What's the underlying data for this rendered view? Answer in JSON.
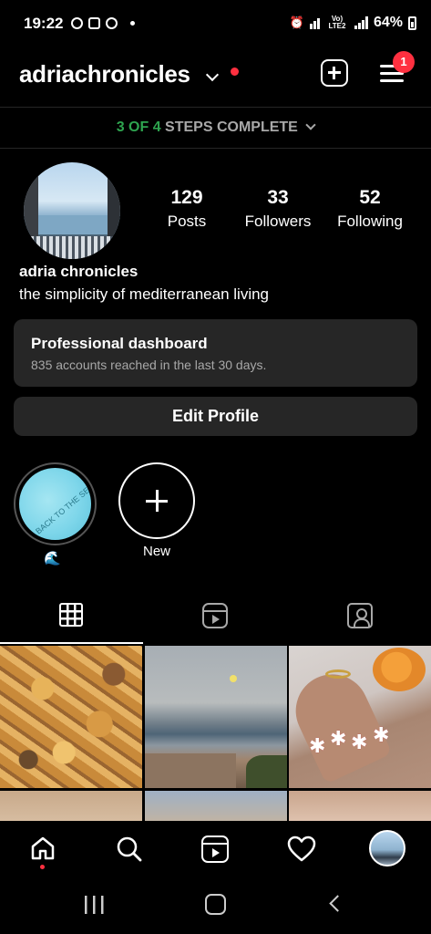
{
  "status_bar": {
    "time": "19:22",
    "network": "Vo) LTE2",
    "battery": "64%"
  },
  "header": {
    "username": "adriachronicles",
    "notification_badge": "1"
  },
  "steps": {
    "progress": "3 OF 4",
    "label": "STEPS COMPLETE"
  },
  "profile": {
    "posts_count": "129",
    "posts_label": "Posts",
    "followers_count": "33",
    "followers_label": "Followers",
    "following_count": "52",
    "following_label": "Following",
    "name": "adria chronicles",
    "bio": "the simplicity of mediterranean living"
  },
  "dashboard": {
    "title": "Professional dashboard",
    "subtitle": "835 accounts reached in the last 30 days."
  },
  "edit_profile_label": "Edit Profile",
  "highlights": {
    "items": [
      {
        "label": "🌊",
        "cover_text": "BACK TO THE SEA"
      },
      {
        "label": "New"
      }
    ]
  },
  "tabs": [
    "grid-icon",
    "reels-icon",
    "tagged-icon"
  ],
  "bottom_nav": [
    "home-icon",
    "search-icon",
    "reels-icon",
    "heart-icon",
    "profile-avatar"
  ],
  "colors": {
    "background": "#000000",
    "surface": "#262626",
    "accent_red": "#ff3040",
    "steps_green": "#2ea44f",
    "muted_text": "#a8a8a8"
  }
}
